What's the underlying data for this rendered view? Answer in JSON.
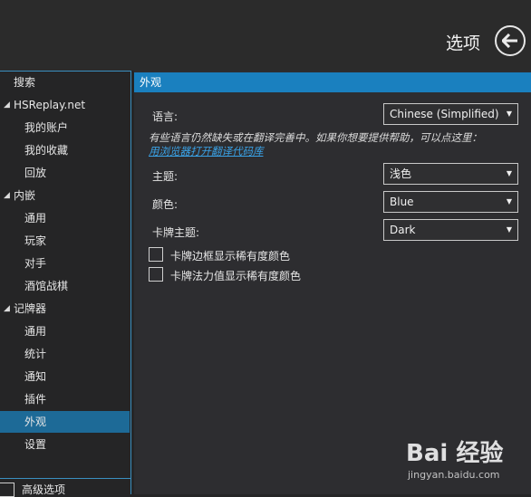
{
  "header": {
    "title": "选项",
    "back_icon": "arrow-left-icon"
  },
  "sidebar": {
    "items": [
      {
        "label": "搜索",
        "level": 0
      },
      {
        "label": "HSReplay.net",
        "level": 0,
        "expanded": true
      },
      {
        "label": "我的账户",
        "level": 1
      },
      {
        "label": "我的收藏",
        "level": 1
      },
      {
        "label": "回放",
        "level": 1
      },
      {
        "label": "内嵌",
        "level": 0,
        "expanded": true
      },
      {
        "label": "通用",
        "level": 1
      },
      {
        "label": "玩家",
        "level": 1
      },
      {
        "label": "对手",
        "level": 1
      },
      {
        "label": "酒馆战棋",
        "level": 1
      },
      {
        "label": "记牌器",
        "level": 0,
        "expanded": true
      },
      {
        "label": "通用",
        "level": 1
      },
      {
        "label": "统计",
        "level": 1
      },
      {
        "label": "通知",
        "level": 1
      },
      {
        "label": "插件",
        "level": 1
      },
      {
        "label": "外观",
        "level": 1,
        "selected": true
      },
      {
        "label": "设置",
        "level": 1
      }
    ],
    "advanced_label": "高级选项"
  },
  "main": {
    "section_title": "外观",
    "language_label": "语言:",
    "language_value": "Chinese (Simplified)",
    "translation_note": "有些语言仍然缺失或在翻译完善中。如果你想要提供帮助，可以点这里：",
    "translation_link": "用浏览器打开翻译代码库",
    "theme_label": "主题:",
    "theme_value": "浅色",
    "color_label": "颜色:",
    "color_value": "Blue",
    "card_theme_label": "卡牌主题:",
    "card_theme_value": "Dark",
    "checkbox_rarity_border": "卡牌边框显示稀有度颜色",
    "checkbox_rarity_mana": "卡牌法力值显示稀有度颜色"
  },
  "watermark": {
    "title": "Bai 经验",
    "sub": "jingyan.baidu.com"
  },
  "colors": {
    "accent": "#1a80bf",
    "selected": "#1d6a97",
    "link": "#3aa3e8"
  }
}
